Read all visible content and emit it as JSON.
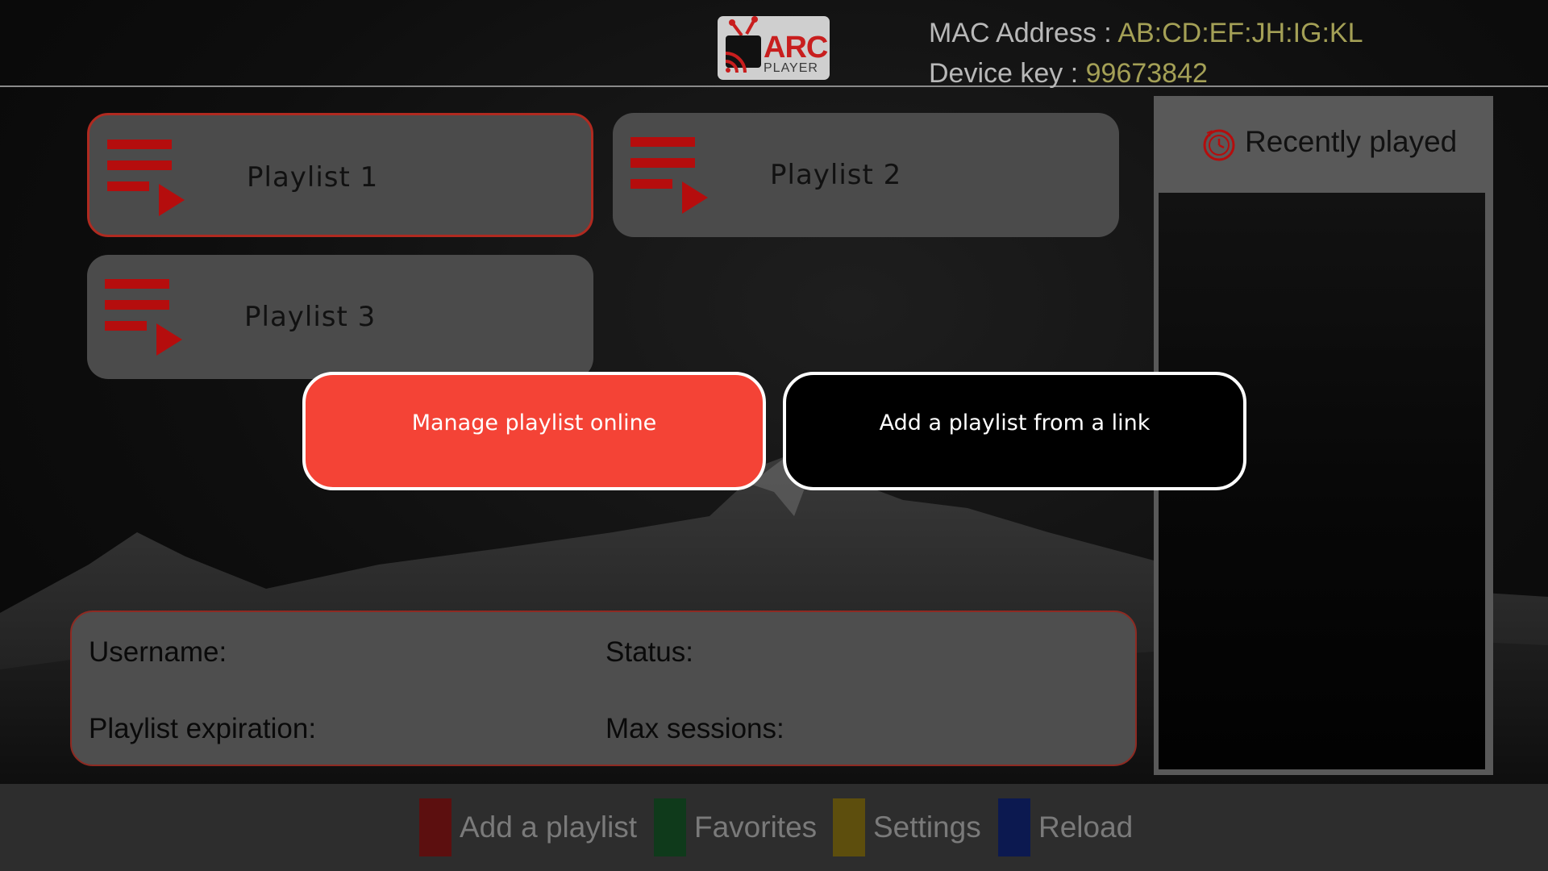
{
  "header": {
    "mac_label": "MAC Address : ",
    "mac_value": "AB:CD:EF:JH:IG:KL",
    "device_key_label": "Device key : ",
    "device_key_value": "99673842",
    "logo_text": "ARC",
    "logo_subtext": "PLAYER"
  },
  "playlists": [
    {
      "label": "Playlist 1",
      "selected": true
    },
    {
      "label": "Playlist 2",
      "selected": false
    },
    {
      "label": "Playlist 3",
      "selected": false
    }
  ],
  "actions": {
    "manage_online": "Manage playlist online",
    "add_from_link": "Add a playlist from a link"
  },
  "info": {
    "username_label": "Username:",
    "status_label": "Status:",
    "expiration_label": "Playlist expiration:",
    "sessions_label": "Max sessions:"
  },
  "recently_played": {
    "title": "Recently played",
    "icon": "clock-icon"
  },
  "bottom_bar": [
    {
      "label": "Add a playlist",
      "color": "#5c0f0f"
    },
    {
      "label": "Favorites",
      "color": "#0f3a1b"
    },
    {
      "label": "Settings",
      "color": "#5d4e0d"
    },
    {
      "label": "Reload",
      "color": "#0c1950"
    }
  ],
  "colors": {
    "accent_red": "#f44336",
    "icon_red": "#b50d0d",
    "value_gold": "#a4a056",
    "card_bg": "#4b4b4b"
  }
}
